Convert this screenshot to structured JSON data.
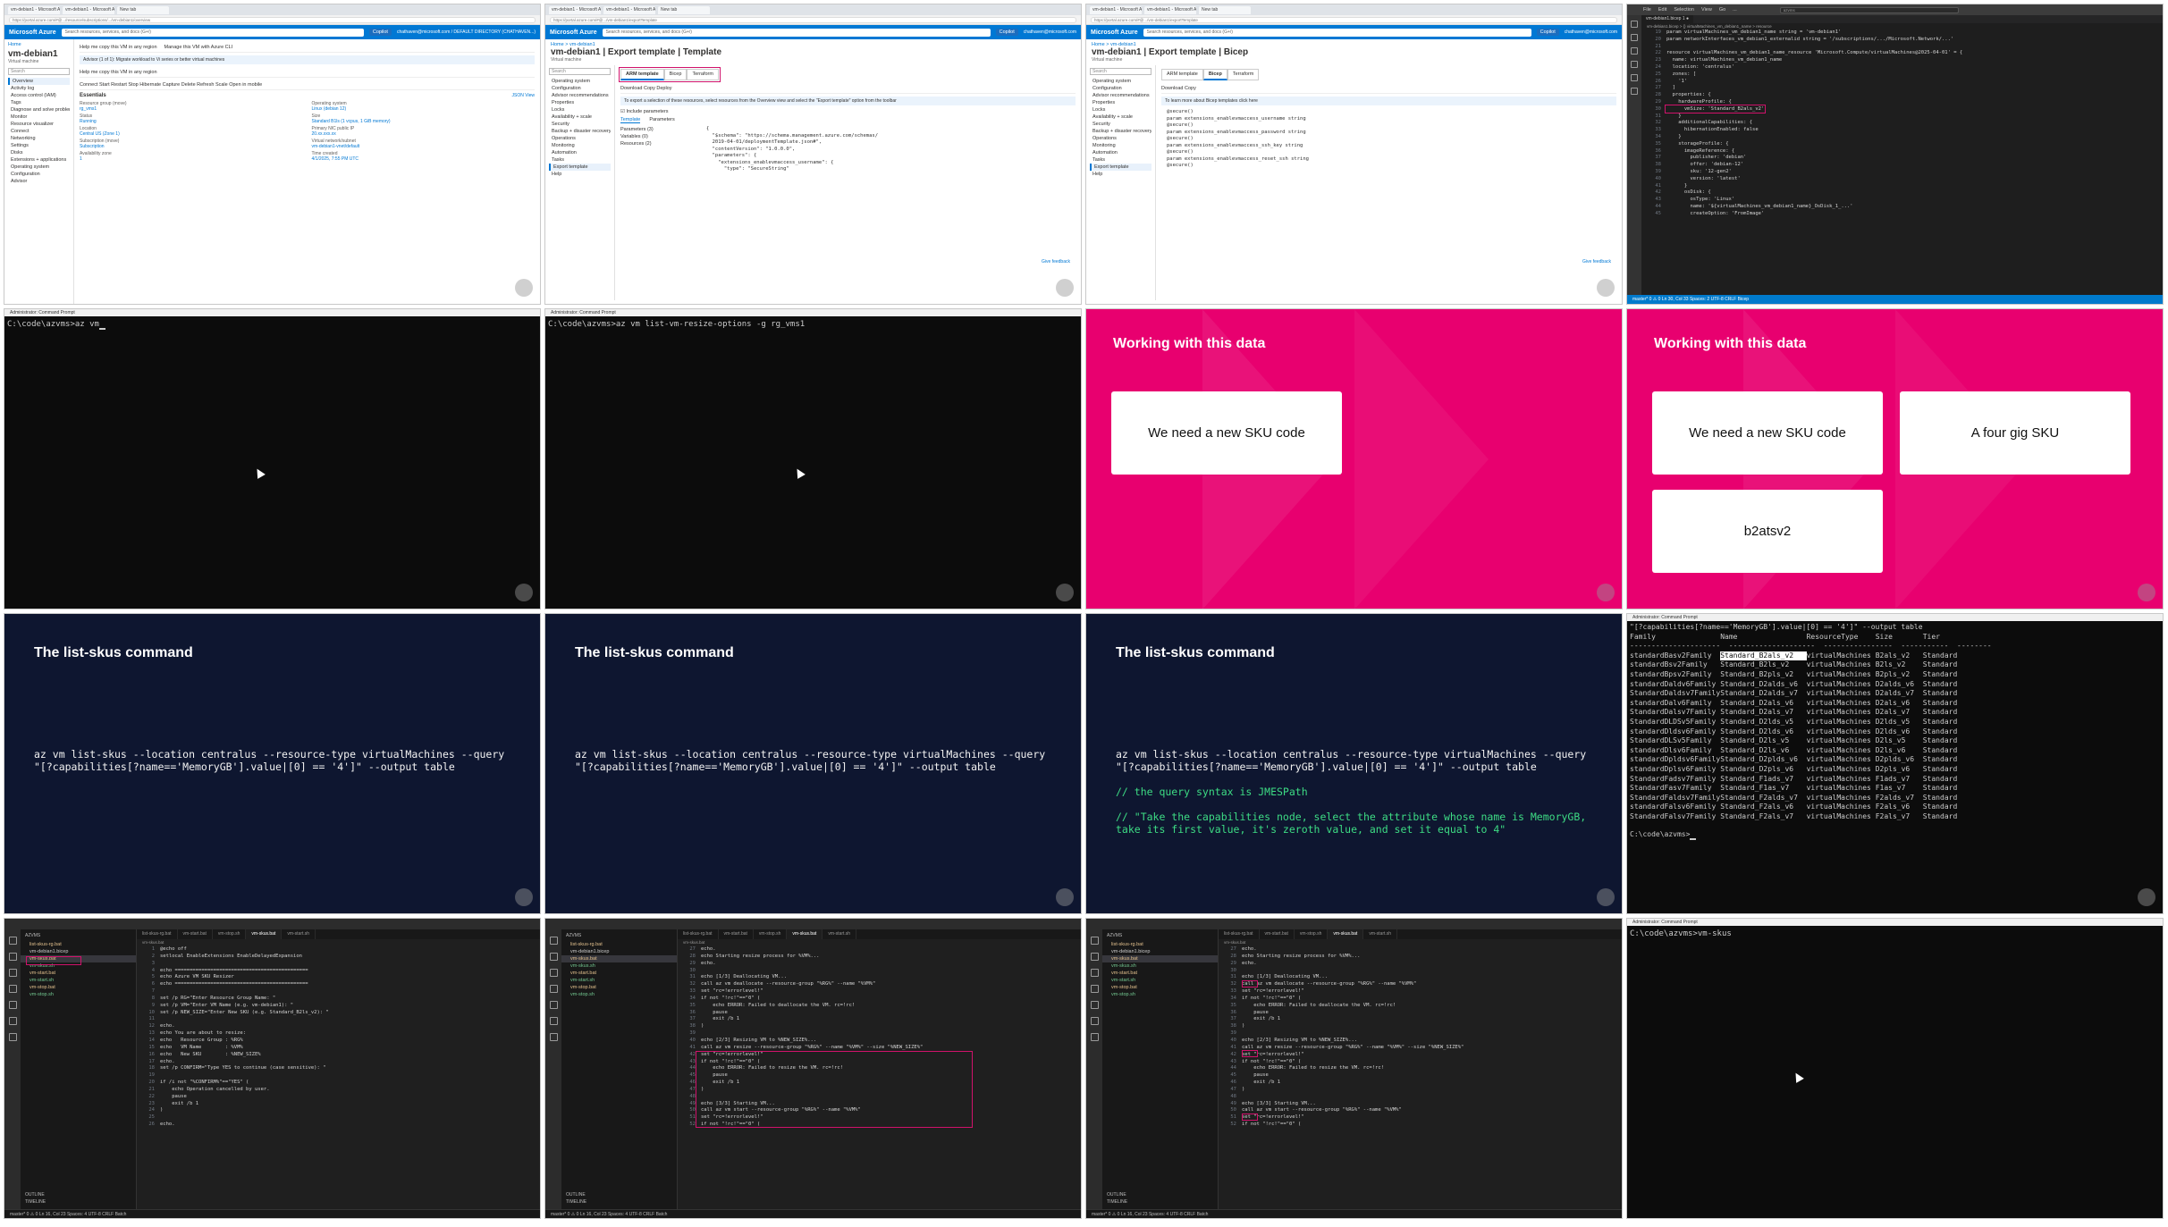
{
  "tile1": {
    "tabs": [
      "vm-debian1 - Microsoft Azure",
      "vm-debian1 - Microsoft Azure",
      "New tab"
    ],
    "url": "https://portal.azure.com/#@.../resource/subscriptions/.../vm-debian1/overview",
    "brand": "Microsoft Azure",
    "search": "Search resources, services, and docs (G+/)",
    "copilot": "Copilot",
    "user": "chathaven@microsoft.com / DEFAULT DIRECTORY (CHATHAVEN...)",
    "crumb": "Home",
    "vm_name": "vm-debian1",
    "vm_type": "Virtual machine",
    "left_search": "Search",
    "nav": [
      "Overview",
      "Activity log",
      "Access control (IAM)",
      "Tags",
      "Diagnose and solve problems",
      "Monitor",
      "Resource visualizer",
      "Connect",
      "Networking",
      "Settings",
      "Disks",
      "Extensions + applications",
      "Operating system",
      "Configuration",
      "Advisor"
    ],
    "prompt1": "Help me copy this VM in any region",
    "prompt2": "Manage this VM with Azure CLI",
    "info": "Advisor (1 of 1): Migrate workload to Vi series or better virtual machines",
    "prompt3": "Help me copy this VM in any region",
    "commands": "Connect  Start  Restart  Stop  Hibernate  Capture  Delete  Refresh  Scale  Open in mobile",
    "essentials": "Essentials",
    "kv": [
      [
        "Resource group (move)",
        "rg_vms1"
      ],
      [
        "Operating system",
        "Linux (debian 12)"
      ],
      [
        "Status",
        "Running"
      ],
      [
        "Size",
        "Standard B1ls (1 vcpus, 1 GiB memory)"
      ],
      [
        "Location",
        "Central US (Zone 1)"
      ],
      [
        "Primary NIC public IP",
        "20.xx.xxx.xx"
      ],
      [
        "Subscription (move)",
        "Subscription"
      ],
      [
        "Virtual network/subnet",
        "vm-debian1-vnet/default"
      ],
      [
        "Availability zone",
        "1"
      ],
      [
        "Time created",
        "4/1/2025, 7:55 PM UTC"
      ]
    ],
    "json_view": "JSON View"
  },
  "tile2": {
    "tabs": [
      "vm-debian1 - Microsoft Azure",
      "vm-debian1 - Microsoft Azure",
      "New tab"
    ],
    "url": "https://portal.azure.com/#@.../vm-debian1/exportTemplate",
    "brand": "Microsoft Azure",
    "search": "Search resources, services, and docs (G+/)",
    "copilot": "Copilot",
    "user": "chathaven@microsoft.com",
    "crumb": "Home > vm-debian1",
    "title": "vm-debian1 | Export template | Template",
    "sub": "Virtual machine",
    "left_search": "Search",
    "nav": [
      "Operating system",
      "Configuration",
      "Advisor recommendations",
      "Properties",
      "Locks",
      "Availability + scale",
      "Security",
      "Backup + disaster recovery",
      "Operations",
      "Monitoring",
      "Automation",
      "Tasks",
      "Export template",
      "Help"
    ],
    "seg": [
      "ARM template",
      "Bicep",
      "Terraform"
    ],
    "cmds": "Download   Copy   Deploy",
    "info": "To export a selection of these resources, select resources from the Overview view and select the \"Export template\" option from the toolbar",
    "include": "Include parameters",
    "subtabs": [
      "Template",
      "Parameters"
    ],
    "tree": [
      "Parameters (3)",
      "Variables (0)",
      "Resources (2)"
    ],
    "code": [
      "{",
      "  \"$schema\": \"https://schema.management.azure.com/schemas/",
      "  2019-04-01/deploymentTemplate.json#\",",
      "  \"contentVersion\": \"1.0.0.0\",",
      "  \"parameters\": {",
      "    \"extensions_enablevmaccess_username\": {",
      "      \"type\": \"SecureString\""
    ],
    "feedback": "Give feedback"
  },
  "tile3": {
    "tabs": [
      "vm-debian1 - Microsoft Azure",
      "vm-debian1 - Microsoft Azure",
      "New tab"
    ],
    "url": "https://portal.azure.com/#@.../vm-debian1/exportTemplate",
    "brand": "Microsoft Azure",
    "search": "Search resources, services, and docs (G+/)",
    "copilot": "Copilot",
    "user": "chathaven@microsoft.com",
    "crumb": "Home > vm-debian1",
    "title": "vm-debian1 | Export template | Bicep",
    "sub": "Virtual machine",
    "left_search": "Search",
    "nav": [
      "Operating system",
      "Configuration",
      "Advisor recommendations",
      "Properties",
      "Locks",
      "Availability + scale",
      "Security",
      "Backup + disaster recovery",
      "Operations",
      "Monitoring",
      "Automation",
      "Tasks",
      "Export template",
      "Help"
    ],
    "seg": [
      "ARM template",
      "Bicep",
      "Terraform"
    ],
    "cmds": "Download   Copy",
    "info": "To learn more about Bicep templates click here",
    "code": [
      "@secure()",
      "param extensions_enablevmaccess_username string",
      "",
      "@secure()",
      "param extensions_enablevmaccess_password string",
      "",
      "@secure()",
      "param extensions_enablevmaccess_ssh_key string",
      "",
      "@secure()",
      "param extensions_enablevmaccess_reset_ssh string",
      "",
      "@secure()"
    ],
    "feedback": "Give feedback"
  },
  "tile4": {
    "menu": [
      "File",
      "Edit",
      "Selection",
      "View",
      "Go",
      "..."
    ],
    "search": "azvms",
    "tab": "vm-debian1.bicep 1 ●",
    "crumb": "vm-debian1.bicep > {} virtualMachines_vm_debian1_name > resource",
    "lines": [
      [
        "19",
        "param virtualMachines_vm_debian1_name string = 'vm-debian1'"
      ],
      [
        "20",
        "param networkInterfaces_vm_debian1_externalid string = '/subscriptions/.../Microsoft.Network/...'"
      ],
      [
        "21",
        ""
      ],
      [
        "22",
        "resource virtualMachines_vm_debian1_name_resource 'Microsoft.Compute/virtualMachines@2025-04-01' = {"
      ],
      [
        "23",
        "  name: virtualMachines_vm_debian1_name"
      ],
      [
        "24",
        "  location: 'centralus'"
      ],
      [
        "25",
        "  zones: ["
      ],
      [
        "26",
        "    '1'"
      ],
      [
        "27",
        "  ]"
      ],
      [
        "28",
        "  properties: {"
      ],
      [
        "29",
        "    hardwareProfile: {"
      ],
      [
        "30",
        "      vmSize: 'Standard_B2als_v2'"
      ],
      [
        "31",
        "    }"
      ],
      [
        "32",
        "    additionalCapabilities: {"
      ],
      [
        "33",
        "      hibernationEnabled: false"
      ],
      [
        "34",
        "    }"
      ],
      [
        "35",
        "    storageProfile: {"
      ],
      [
        "36",
        "      imageReference: {"
      ],
      [
        "37",
        "        publisher: 'debian'"
      ],
      [
        "38",
        "        offer: 'debian-12'"
      ],
      [
        "39",
        "        sku: '12-gen2'"
      ],
      [
        "40",
        "        version: 'latest'"
      ],
      [
        "41",
        "      }"
      ],
      [
        "42",
        "      osDisk: {"
      ],
      [
        "43",
        "        osType: 'Linux'"
      ],
      [
        "44",
        "        name: '${virtualMachines_vm_debian1_name}_OsDisk_1_...'"
      ],
      [
        "45",
        "        createOption: 'FromImage'"
      ]
    ],
    "status": "master*   0 ⚠ 0   Ln 30, Col 33   Spaces: 2   UTF-8   CRLF   Bicep"
  },
  "tile5": {
    "titlebar": "Administrator: Command Prompt",
    "line": "C:\\code\\azvms>az vm"
  },
  "tile6": {
    "titlebar": "Administrator: Command Prompt",
    "line": "C:\\code\\azvms>az vm list-vm-resize-options -g rg_vms1"
  },
  "tile7": {
    "title": "Working with this data",
    "cards": [
      "We need a new SKU code"
    ]
  },
  "tile8": {
    "title": "Working with this data",
    "cards": [
      "We need a new SKU code",
      "A four gig SKU",
      "b2atsv2"
    ]
  },
  "tile9": {
    "title": "The list-skus command",
    "code": "az vm list-skus --location centralus --resource-type virtualMachines --query\n\"[?capabilities[?name=='MemoryGB'].value|[0] == '4']\" --output table"
  },
  "tile10": {
    "title": "The list-skus command",
    "code": "az vm list-skus --location centralus --resource-type virtualMachines --query\n\"[?capabilities[?name=='MemoryGB'].value|[0] == '4']\" --output table"
  },
  "tile11": {
    "title": "The list-skus command",
    "code": "az vm list-skus --location centralus --resource-type virtualMachines --query\n\"[?capabilities[?name=='MemoryGB'].value|[0] == '4']\" --output table",
    "comment1": "// the query syntax is JMESPath",
    "comment2": "// \"Take the capabilities node, select the attribute whose name is MemoryGB,\ntake its first value, it's zeroth value, and set it equal to 4\""
  },
  "tile12": {
    "titlebar": "Administrator: Command Prompt",
    "cmd": "\"[?capabilities[?name=='MemoryGB'].value|[0] == '4']\" --output table",
    "headers": [
      "Family",
      "Name",
      "ResourceType",
      "Size",
      "Tier"
    ],
    "rows": [
      [
        "standardBasv2Family",
        "Standard_B2als_v2",
        "virtualMachines",
        "B2als_v2",
        "Standard"
      ],
      [
        "standardBsv2Family",
        "Standard_B2ls_v2",
        "virtualMachines",
        "B2ls_v2",
        "Standard"
      ],
      [
        "standardBpsv2Family",
        "Standard_B2pls_v2",
        "virtualMachines",
        "B2pls_v2",
        "Standard"
      ],
      [
        "standardDaldv6Family",
        "Standard_D2alds_v6",
        "virtualMachines",
        "D2alds_v6",
        "Standard"
      ],
      [
        "StandardDaldsv7Family",
        "Standard_D2alds_v7",
        "virtualMachines",
        "D2alds_v7",
        "Standard"
      ],
      [
        "standardDalv6Family",
        "Standard_D2als_v6",
        "virtualMachines",
        "D2als_v6",
        "Standard"
      ],
      [
        "StandardDalsv7Family",
        "Standard_D2als_v7",
        "virtualMachines",
        "D2als_v7",
        "Standard"
      ],
      [
        "StandardDLDSv5Family",
        "Standard_D2lds_v5",
        "virtualMachines",
        "D2lds_v5",
        "Standard"
      ],
      [
        "standardDldsv6Family",
        "Standard_D2lds_v6",
        "virtualMachines",
        "D2lds_v6",
        "Standard"
      ],
      [
        "StandardDLSv5Family",
        "Standard_D2ls_v5",
        "virtualMachines",
        "D2ls_v5",
        "Standard"
      ],
      [
        "standardDlsv6Family",
        "Standard_D2ls_v6",
        "virtualMachines",
        "D2ls_v6",
        "Standard"
      ],
      [
        "standardDpldsv6Family",
        "Standard_D2plds_v6",
        "virtualMachines",
        "D2plds_v6",
        "Standard"
      ],
      [
        "standardDplsv6Family",
        "Standard_D2pls_v6",
        "virtualMachines",
        "D2pls_v6",
        "Standard"
      ],
      [
        "StandardFadsv7Family",
        "Standard_F1ads_v7",
        "virtualMachines",
        "F1ads_v7",
        "Standard"
      ],
      [
        "StandardFasv7Family",
        "Standard_F1as_v7",
        "virtualMachines",
        "F1as_v7",
        "Standard"
      ],
      [
        "StandardFaldsv7Family",
        "Standard_F2alds_v7",
        "virtualMachines",
        "F2alds_v7",
        "Standard"
      ],
      [
        "standardFalsv6Family",
        "Standard_F2als_v6",
        "virtualMachines",
        "F2als_v6",
        "Standard"
      ],
      [
        "StandardFalsv7Family",
        "Standard_F2als_v7",
        "virtualMachines",
        "F2als_v7",
        "Standard"
      ]
    ],
    "prompt": "C:\\code\\azvms>"
  },
  "explorer": {
    "header": "AZVMS",
    "files": [
      "list-skus-rg.bat",
      "vm-debian1.bicep",
      "vm-skus.bat",
      "vm-skus.sh",
      "vm-start.bat",
      "vm-start.sh",
      "vm-stop.bat",
      "vm-stop.sh"
    ],
    "outline": [
      "OUTLINE",
      "TIMELINE"
    ]
  },
  "tile13": {
    "tabs": [
      "list-skus-rg.bat",
      "vm-start.bat",
      "vm-stop.sh",
      "vm-skus.bat",
      "vm-start.sh"
    ],
    "crumb": "vm-skus.bat",
    "lines": [
      [
        "1",
        "@echo off"
      ],
      [
        "2",
        "setlocal EnableExtensions EnableDelayedExpansion"
      ],
      [
        "3",
        ""
      ],
      [
        "4",
        "echo ============================================="
      ],
      [
        "5",
        "echo Azure VM SKU Resizer"
      ],
      [
        "6",
        "echo ============================================="
      ],
      [
        "7",
        ""
      ],
      [
        "8",
        "set /p RG=\"Enter Resource Group Name: \""
      ],
      [
        "9",
        "set /p VM=\"Enter VM Name (e.g. vm-debian1): \""
      ],
      [
        "10",
        "set /p NEW_SIZE=\"Enter New SKU (e.g. Standard_B2ls_v2): \""
      ],
      [
        "11",
        ""
      ],
      [
        "12",
        "echo."
      ],
      [
        "13",
        "echo You are about to resize:"
      ],
      [
        "14",
        "echo   Resource Group : %RG%"
      ],
      [
        "15",
        "echo   VM Name        : %VM%"
      ],
      [
        "16",
        "echo   New SKU        : %NEW_SIZE%"
      ],
      [
        "17",
        "echo."
      ],
      [
        "18",
        "set /p CONFIRM=\"Type YES to continue (case sensitive): \""
      ],
      [
        "19",
        ""
      ],
      [
        "20",
        "if /i not \"%CONFIRM%\"==\"YES\" ("
      ],
      [
        "21",
        "    echo Operation cancelled by user."
      ],
      [
        "22",
        "    pause"
      ],
      [
        "23",
        "    exit /b 1"
      ],
      [
        "24",
        ")"
      ],
      [
        "25",
        ""
      ],
      [
        "26",
        "echo."
      ]
    ],
    "status": "master*   0 ⚠ 0   Ln 16, Col 23   Spaces: 4   UTF-8   CRLF   Batch"
  },
  "tile14": {
    "tabs": [
      "list-skus-rg.bat",
      "vm-start.bat",
      "vm-stop.sh",
      "vm-skus.bat",
      "vm-start.sh"
    ],
    "crumb": "vm-skus.bat",
    "lines": [
      [
        "27",
        "echo."
      ],
      [
        "28",
        "echo Starting resize process for %VM%..."
      ],
      [
        "29",
        "echo."
      ],
      [
        "30",
        ""
      ],
      [
        "31",
        "echo [1/3] Deallocating VM..."
      ],
      [
        "32",
        "call az vm deallocate --resource-group \"%RG%\" --name \"%VM%\""
      ],
      [
        "33",
        "set \"rc=!errorlevel!\""
      ],
      [
        "34",
        "if not \"!rc!\"==\"0\" ("
      ],
      [
        "35",
        "    echo ERROR: Failed to deallocate the VM. rc=!rc!"
      ],
      [
        "36",
        "    pause"
      ],
      [
        "37",
        "    exit /b 1"
      ],
      [
        "38",
        ")"
      ],
      [
        "39",
        ""
      ],
      [
        "40",
        "echo [2/3] Resizing VM to %NEW_SIZE%..."
      ],
      [
        "41",
        "call az vm resize --resource-group \"%RG%\" --name \"%VM%\" --size \"%NEW_SIZE%\""
      ],
      [
        "42",
        "set \"rc=!errorlevel!\""
      ],
      [
        "43",
        "if not \"!rc!\"==\"0\" ("
      ],
      [
        "44",
        "    echo ERROR: Failed to resize the VM. rc=!rc!"
      ],
      [
        "45",
        "    pause"
      ],
      [
        "46",
        "    exit /b 1"
      ],
      [
        "47",
        ")"
      ],
      [
        "48",
        ""
      ],
      [
        "49",
        "echo [3/3] Starting VM..."
      ],
      [
        "50",
        "call az vm start --resource-group \"%RG%\" --name \"%VM%\""
      ],
      [
        "51",
        "set \"rc=!errorlevel!\""
      ],
      [
        "52",
        "if not \"!rc!\"==\"0\" ("
      ]
    ],
    "status": "master*   0 ⚠ 0   Ln 16, Col 23   Spaces: 4   UTF-8   CRLF   Batch"
  },
  "tile15": {
    "tabs": [
      "list-skus-rg.bat",
      "vm-start.bat",
      "vm-stop.sh",
      "vm-skus.bat",
      "vm-start.sh"
    ],
    "crumb": "vm-skus.bat",
    "lines": [
      [
        "27",
        "echo."
      ],
      [
        "28",
        "echo Starting resize process for %VM%..."
      ],
      [
        "29",
        "echo."
      ],
      [
        "30",
        ""
      ],
      [
        "31",
        "echo [1/3] Deallocating VM..."
      ],
      [
        "32",
        "call az vm deallocate --resource-group \"%RG%\" --name \"%VM%\""
      ],
      [
        "33",
        "set \"rc=!errorlevel!\""
      ],
      [
        "34",
        "if not \"!rc!\"==\"0\" ("
      ],
      [
        "35",
        "    echo ERROR: Failed to deallocate the VM. rc=!rc!"
      ],
      [
        "36",
        "    pause"
      ],
      [
        "37",
        "    exit /b 1"
      ],
      [
        "38",
        ")"
      ],
      [
        "39",
        ""
      ],
      [
        "40",
        "echo [2/3] Resizing VM to %NEW_SIZE%..."
      ],
      [
        "41",
        "call az vm resize --resource-group \"%RG%\" --name \"%VM%\" --size \"%NEW_SIZE%\""
      ],
      [
        "42",
        "set \"rc=!errorlevel!\""
      ],
      [
        "43",
        "if not \"!rc!\"==\"0\" ("
      ],
      [
        "44",
        "    echo ERROR: Failed to resize the VM. rc=!rc!"
      ],
      [
        "45",
        "    pause"
      ],
      [
        "46",
        "    exit /b 1"
      ],
      [
        "47",
        ")"
      ],
      [
        "48",
        ""
      ],
      [
        "49",
        "echo [3/3] Starting VM..."
      ],
      [
        "50",
        "call az vm start --resource-group \"%RG%\" --name \"%VM%\""
      ],
      [
        "51",
        "set \"rc=!errorlevel!\""
      ],
      [
        "52",
        "if not \"!rc!\"==\"0\" ("
      ]
    ],
    "status": "master*   0 ⚠ 0   Ln 16, Col 23   Spaces: 4   UTF-8   CRLF   Batch"
  },
  "tile16": {
    "titlebar": "Administrator: Command Prompt",
    "line": "C:\\code\\azvms>vm-skus"
  }
}
